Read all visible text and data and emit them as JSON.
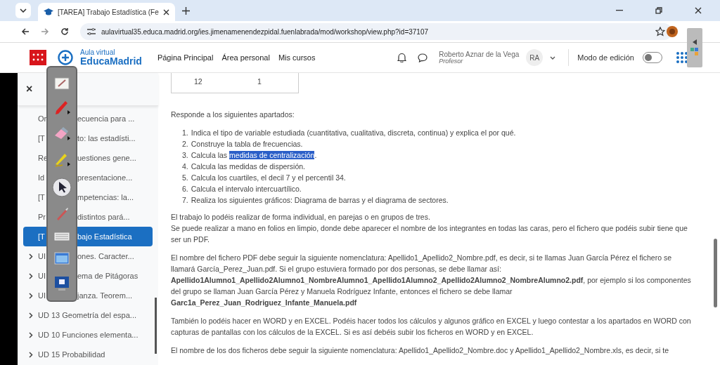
{
  "browser": {
    "tab_title": "[TAREA] Trabajo Estadística (Fe",
    "url": "aulavirtual35.educa.madrid.org/ies.jimenamenendezpidal.fuenlabrada/mod/workshop/view.php?id=37107"
  },
  "header": {
    "logo_top": "Aula virtual",
    "logo_bottom": "EducaMadrid",
    "nav": [
      "Página Principal",
      "Área personal",
      "Mis cursos"
    ],
    "user_name": "Roberto Aznar de la Vega",
    "user_role": "Profesor",
    "initials": "RA",
    "edit_mode_label": "Modo de edición",
    "edit_mode_on": false
  },
  "sidebar": {
    "close": "×",
    "items": [
      {
        "before": "Or",
        "after": "ecuencia para ...",
        "chevron": false,
        "selected": false
      },
      {
        "before": "[T",
        "after": "to: las estadísti...",
        "chevron": false,
        "selected": false
      },
      {
        "before": "Re",
        "after": "uestiones gene...",
        "chevron": false,
        "selected": false
      },
      {
        "before": "Id",
        "after": "presentacione...",
        "chevron": false,
        "selected": false
      },
      {
        "before": "[T",
        "after": "mpetencias: la...",
        "chevron": false,
        "selected": false
      },
      {
        "before": "Pr",
        "after": "distintos pará...",
        "chevron": false,
        "selected": false
      },
      {
        "before": "[T",
        "after": "bajo Estadística",
        "chevron": false,
        "selected": true
      },
      {
        "before": "UI",
        "after": "ones. Caracter...",
        "chevron": true,
        "selected": false
      },
      {
        "before": "UI",
        "after": "ema de Pitágoras",
        "chevron": true,
        "selected": false
      },
      {
        "before": "UI",
        "after": "janza. Teorem...",
        "chevron": true,
        "selected": false
      },
      {
        "before": "UD 13 Geometría del espa...",
        "chevron": true,
        "selected": false
      },
      {
        "before": "UD 10 Funciones elementa...",
        "chevron": true,
        "selected": false
      },
      {
        "before": "UD 15 Probabilidad",
        "chevron": true,
        "selected": false
      }
    ]
  },
  "table_rows": [
    [
      "12",
      "1"
    ]
  ],
  "intro": "Responde a los siguientes apartados:",
  "tasks": [
    {
      "number": "1.",
      "text": "Indica el tipo de variable estudiada (cuantitativa, cualitativa, discreta, continua) y explica el por qué."
    },
    {
      "number": "2.",
      "text": "Construye la tabla de frecuencias."
    },
    {
      "number": "3.",
      "text": "Calcula las ",
      "highlight": "medidas de centralización",
      "after": "."
    },
    {
      "number": "4.",
      "text": "Calcula las medidas de dispersión."
    },
    {
      "number": "5.",
      "text": "Calcula los cuartiles, el decil 7 y el percentil 34."
    },
    {
      "number": "6.",
      "text": "Calcula el intervalo intercuartílico."
    },
    {
      "number": "7.",
      "text": "Realiza los siguientes gráficos: Diagrama de barras y el diagrama de sectores."
    }
  ],
  "paragraphs": [
    [
      "El trabajo lo podéis realizar de forma individual, en parejas o en grupos de tres.",
      "Se puede realizar a mano en folios en limpio, donde debe aparecer el nombre de los integrantes en todas las caras, pero el fichero que podéis subir tiene que ser un PDF."
    ],
    [
      "El nombre del fichero PDF debe seguir la siguiente nomenclatura: Apellido1_Apellido2_Nombre.pdf, es decir, si te llamas Juan García Pérez el fichero se llamará García_Perez_Juan.pdf. Si el grupo estuviera formado por dos personas, se debe llamar así: **Apellido1Alumno1_Apellido2Alumno1_NombreAlumno1_Apellido1Alumno2_Apellido2Alumno2_NombreAlumno2.pdf**, por ejemplo si los componentes del grupo se llaman Juan García Pérez y Manuela Rodríguez Infante, entonces el fichero se debe llamar **Garc1a_Perez_Juan_Rodriguez_Infante_Manuela.pdf**"
    ],
    [
      "También lo podéis hacer en WORD y en EXCEL. Podéis hacer todos los cálculos y algunos gráfico en EXCEL y luego contestar a los apartados en WORD con capturas de pantallas con los cálculos de la EXCEL. Si es así debéis subir los ficheros en WORD y en EXCEL."
    ],
    [
      "El nombre de los dos ficheros debe seguir la siguiente nomenclatura: Apellido1_Apellido2_Nombre.doc y Apellido1_Apellido2_Nombre.xls, es decir, si te"
    ]
  ]
}
